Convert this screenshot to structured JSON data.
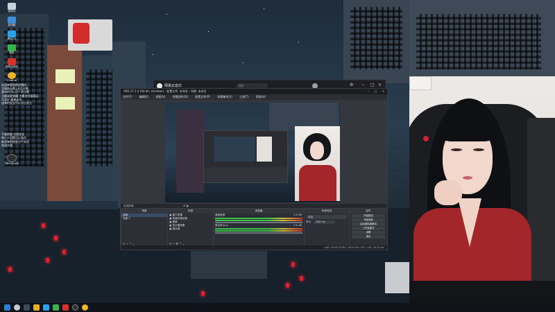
{
  "desktop": {
    "icons": [
      {
        "label": "回收站",
        "color": "#c9d3de"
      },
      {
        "label": "此电脑",
        "color": "#3b8fd9"
      },
      {
        "label": "腾讯QQ",
        "color": "#2aa3ef"
      },
      {
        "label": "微信",
        "color": "#38b54a"
      },
      {
        "label": "网易云音乐",
        "color": "#d8322b"
      },
      {
        "label": "Chrome",
        "color": "#f0b429"
      },
      {
        "label": "OBS Studio",
        "color": "#2d2f33"
      }
    ],
    "notes": [
      "欢迎来到我的直播间",
      "主播每天晚上8点开播",
      "喜欢的可以点个关注哦",
      "点歌请发弹幕 主播会尽量满足",
      "大家好 谢谢支持",
      "进来的宝宝可以点点关注",
      "不要刷屏 文明发言",
      "有什么问题可以私信",
      "新进来的朋友点个关注",
      "欢迎大家"
    ]
  },
  "music_player": {
    "title": "网易云音乐",
    "search_placeholder": "搜索"
  },
  "obs": {
    "title": "OBS 27.2.4 (64-bit, windows) - 配置文件: 未命名 - 场景: 未命名",
    "menu": [
      "文件(F)",
      "编辑(E)",
      "视图(V)",
      "停靠部件(D)",
      "配置文件(P)",
      "场景集合(S)",
      "工具(T)",
      "帮助(H)"
    ],
    "source_bar_label": "未选择源",
    "docks": {
      "scenes": {
        "header": "场景",
        "items": [
          "场景",
          "场景 2"
        ]
      },
      "sources": {
        "header": "来源",
        "items": [
          "窗口采集",
          "视频采集设备",
          "图像",
          "显示器采集",
          "媒体源"
        ]
      },
      "mixer": {
        "header": "混音器",
        "channels": [
          {
            "name": "桌面音频",
            "level": "0.0 dB"
          },
          {
            "name": "麦克风/Aux",
            "level": "0.0 dB"
          }
        ]
      },
      "transitions": {
        "header": "转场特效",
        "type": "淡出",
        "duration_label": "时长",
        "duration": "300 ms"
      },
      "controls": {
        "header": "控件",
        "buttons": [
          "开始推流",
          "开始录制",
          "启动虚拟摄像机",
          "工作室模式",
          "设置",
          "退出"
        ]
      }
    },
    "status": "LIVE: 00:00:00   REC: 00:00:00   CPU: 2.4%, 30.00 fps"
  },
  "colors": {
    "accent_red": "#e0202c",
    "window_bg": "#26282d"
  }
}
